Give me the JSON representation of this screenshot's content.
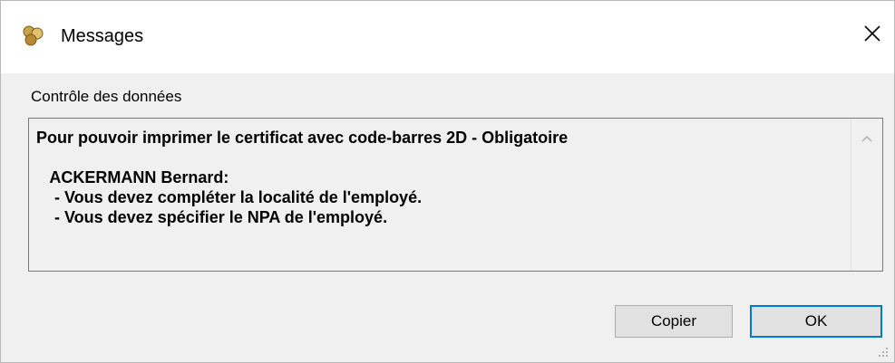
{
  "window": {
    "title": "Messages",
    "close_icon": "close-icon",
    "app_icon": "users-icon"
  },
  "section": {
    "label": "Contrôle des données"
  },
  "message": {
    "line1": "Pour pouvoir imprimer le certificat avec code-barres 2D - Obligatoire",
    "employee": "   ACKERMANN Bernard:",
    "issue1": "    - Vous devez compléter la localité de l'employé.",
    "issue2": "    - Vous devez spécifier le NPA de l'employé."
  },
  "buttons": {
    "copy_label": "Copier",
    "ok_label": "OK"
  },
  "colors": {
    "accent": "#0078d7",
    "background": "#f0f0f0"
  }
}
